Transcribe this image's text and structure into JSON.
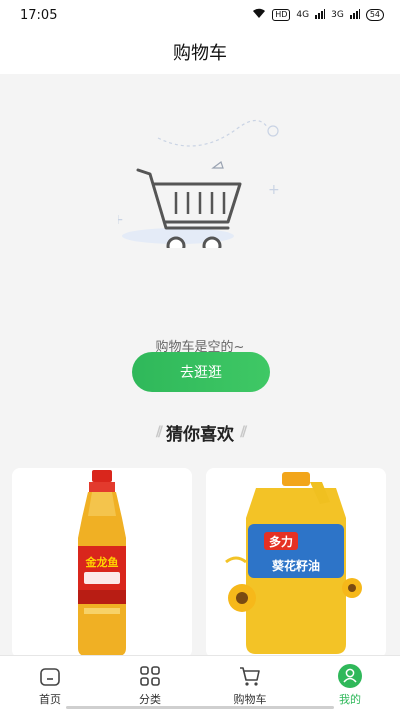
{
  "status": {
    "time": "17:05",
    "hd": "HD",
    "network1": "4G",
    "network2": "3G",
    "battery": "54"
  },
  "header": {
    "title": "购物车"
  },
  "empty": {
    "message": "购物车是空的~"
  },
  "actions": {
    "browse_label": "去逛逛"
  },
  "recommend": {
    "title": "猜你喜欢"
  },
  "products": [
    {
      "name": "金龙鱼 食用植物调和油",
      "bottle_label": "金龙鱼",
      "color": "#e8a21a"
    },
    {
      "name": "多力 葵花籽油",
      "bottle_label": "葵花籽油",
      "brand": "多力",
      "color": "#f0c020"
    }
  ],
  "tabs": [
    {
      "label": "首页",
      "icon": "home-icon"
    },
    {
      "label": "分类",
      "icon": "category-grid-icon"
    },
    {
      "label": "购物车",
      "icon": "cart-icon"
    },
    {
      "label": "我的",
      "icon": "user-icon"
    }
  ],
  "colors": {
    "accent": "#2fb85a",
    "background": "#f4f4f4"
  }
}
